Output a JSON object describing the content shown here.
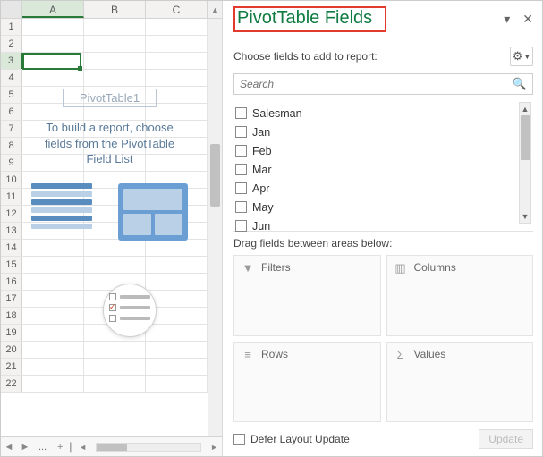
{
  "columns": [
    "A",
    "B",
    "C"
  ],
  "active_column_index": 0,
  "row_count": 22,
  "active_row": 3,
  "pivot_placeholder": {
    "name": "PivotTable1",
    "text": "To build a report, choose fields from the PivotTable Field List"
  },
  "tabstrip": {
    "dots": "...",
    "add": "+"
  },
  "pane": {
    "title": "PivotTable Fields",
    "subtitle": "Choose fields to add to report:",
    "search_placeholder": "Search",
    "fields": [
      "Salesman",
      "Jan",
      "Feb",
      "Mar",
      "Apr",
      "May",
      "Jun"
    ],
    "drag_label": "Drag fields between areas below:",
    "areas": {
      "filters": "Filters",
      "columns": "Columns",
      "rows": "Rows",
      "values": "Values"
    },
    "footer": {
      "defer_label": "Defer Layout Update",
      "update_label": "Update"
    }
  }
}
